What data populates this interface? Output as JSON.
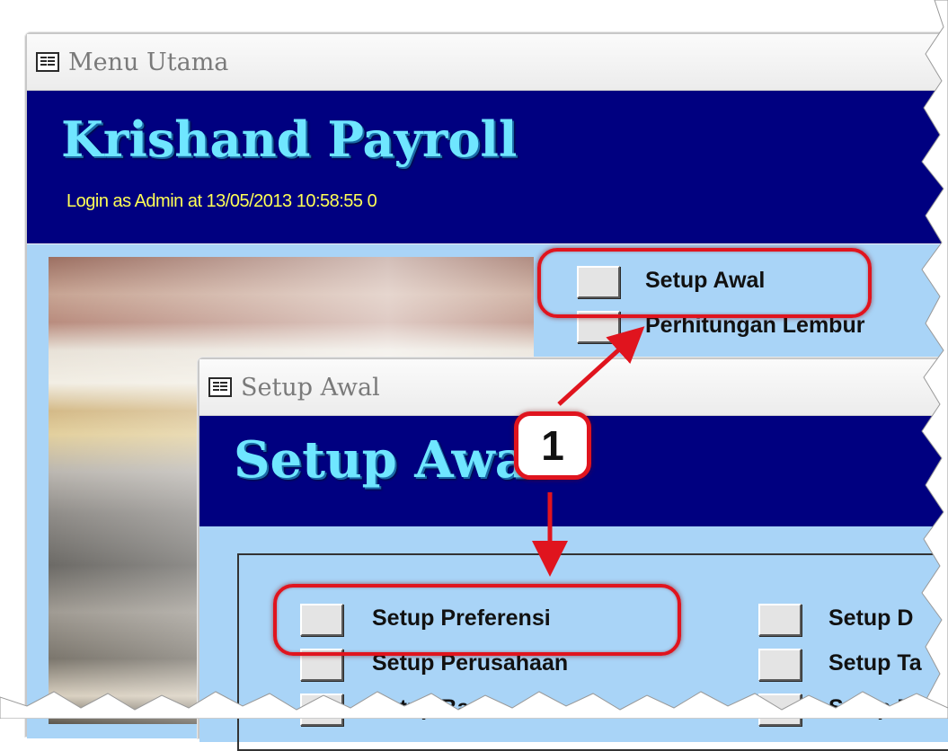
{
  "main_window": {
    "title": "Menu Utama",
    "app_title": "Krishand Payroll",
    "login_text": "Login as Admin at 13/05/2013 10:58:55 0",
    "menu_items": [
      {
        "label": "Setup Awal"
      },
      {
        "label": "Perhitungan Lembur"
      }
    ]
  },
  "setup_window": {
    "title": "Setup Awal",
    "banner_title": "Setup Awal",
    "left_items": [
      {
        "label": "Setup Preferensi"
      },
      {
        "label": "Setup Perusahaan"
      },
      {
        "label": "Setup Bank"
      }
    ],
    "right_items": [
      {
        "label": "Setup D"
      },
      {
        "label": "Setup Ta"
      },
      {
        "label": "Setup Ma"
      }
    ]
  },
  "annotation": {
    "callout_number": "1",
    "color": "#e0141e"
  },
  "colors": {
    "banner": "#000080",
    "panel": "#a9d4f7",
    "app_title": "#6fe6ff",
    "login_text": "#ffff55"
  }
}
